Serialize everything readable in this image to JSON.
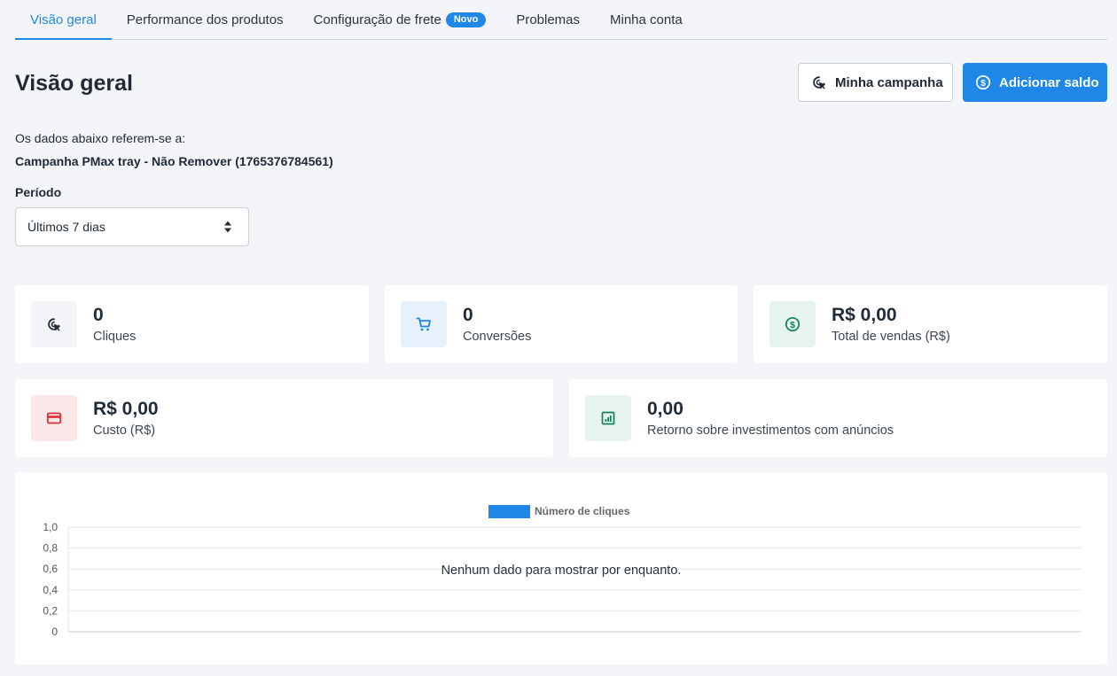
{
  "tabs": [
    {
      "label": "Visão geral",
      "active": true
    },
    {
      "label": "Performance dos produtos"
    },
    {
      "label": "Configuração de frete",
      "badge": "Novo"
    },
    {
      "label": "Problemas"
    },
    {
      "label": "Minha conta"
    }
  ],
  "header": {
    "title": "Visão geral",
    "campaign_button": "Minha campanha",
    "add_balance_button": "Adicionar saldo"
  },
  "info": {
    "intro": "Os dados abaixo referem-se a:",
    "campaign_name": "Campanha PMax tray - Não Remover (1765376784561)"
  },
  "period": {
    "label": "Período",
    "selected": "Últimos 7 dias"
  },
  "metrics": {
    "clicks": {
      "value": "0",
      "label": "Cliques",
      "icon": "cursor-click-icon"
    },
    "conversions": {
      "value": "0",
      "label": "Conversões",
      "icon": "cart-icon"
    },
    "sales": {
      "value": "R$ 0,00",
      "label": "Total de vendas (R$)",
      "icon": "dollar-icon"
    },
    "cost": {
      "value": "R$ 0,00",
      "label": "Custo (R$)",
      "icon": "credit-card-icon"
    },
    "roas": {
      "value": "0,00",
      "label": "Retorno sobre investimentos com anúncios",
      "icon": "chart-icon"
    }
  },
  "colors": {
    "accent": "#1f87e8",
    "clicks_bg": "#f4f5f9",
    "conversions_bg": "#e6f1fc",
    "sales_bg": "#e6f3ee",
    "cost_bg": "#fbe9ea",
    "roas_bg": "#e6f3ee"
  },
  "chart_data": {
    "type": "bar",
    "legend": [
      "Número de cliques"
    ],
    "series": [
      {
        "name": "Número de cliques",
        "values": []
      }
    ],
    "categories": [],
    "y_ticks": [
      "1,0",
      "0,8",
      "0,6",
      "0,4",
      "0,2",
      "0"
    ],
    "ylim": [
      0,
      1
    ],
    "grid": true,
    "legend_position": "top",
    "empty_message": "Nenhum dado para mostrar por enquanto."
  }
}
